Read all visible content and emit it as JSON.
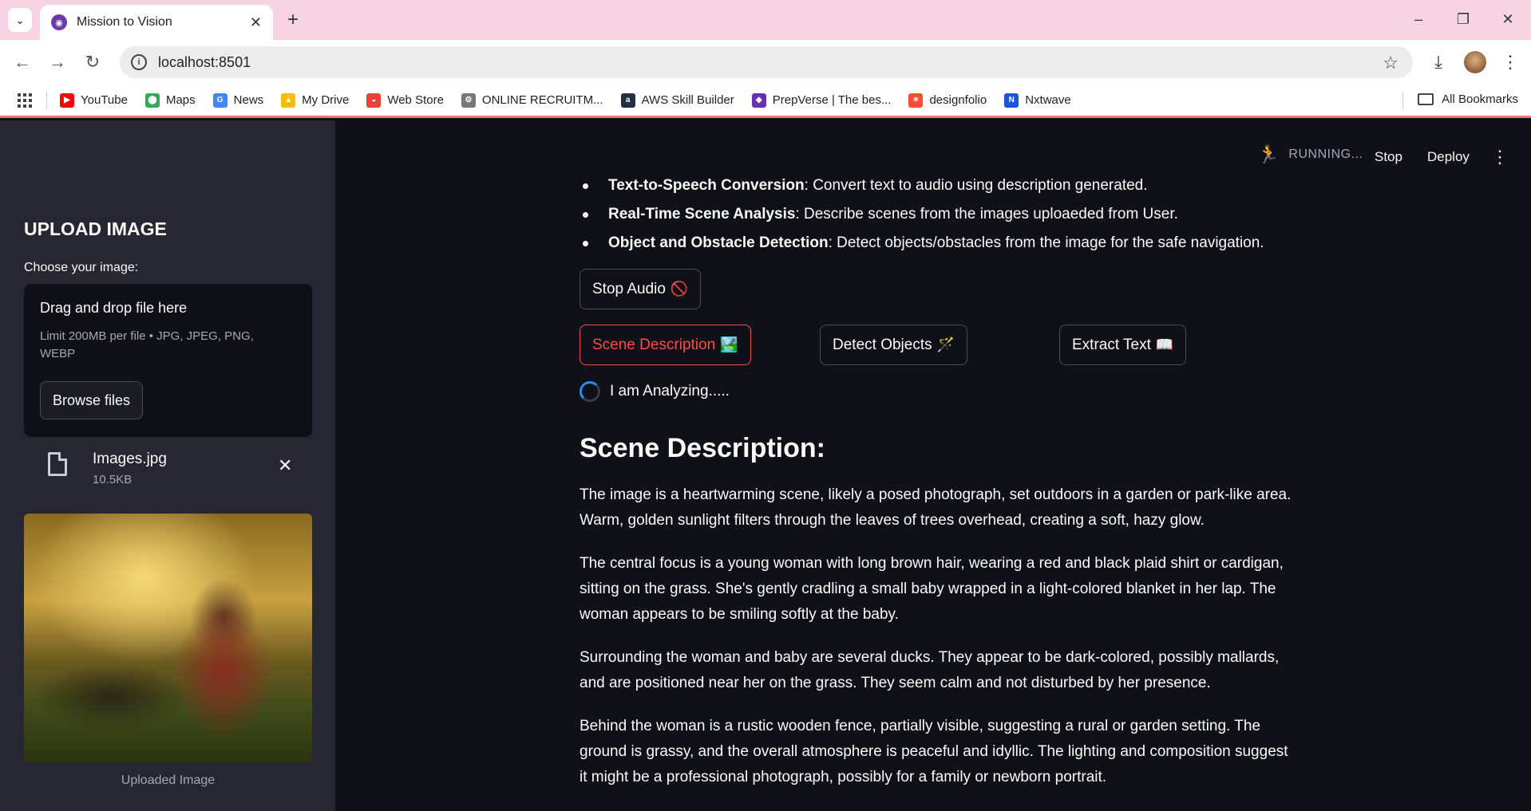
{
  "browser": {
    "tab_title": "Mission to Vision",
    "url": "localhost:8501",
    "bookmarks": [
      {
        "label": "YouTube",
        "icon": "youtube-icon",
        "color": "#ff0000"
      },
      {
        "label": "Maps",
        "icon": "maps-icon",
        "color": "#34a853"
      },
      {
        "label": "News",
        "icon": "news-icon",
        "color": "#4285f4"
      },
      {
        "label": "My Drive",
        "icon": "drive-icon",
        "color": "#fbbc04"
      },
      {
        "label": "Web Store",
        "icon": "webstore-icon",
        "color": "#ea4335"
      },
      {
        "label": "ONLINE RECRUITM...",
        "icon": "recruitment-icon",
        "color": "#777777"
      },
      {
        "label": "AWS Skill Builder",
        "icon": "aws-icon",
        "color": "#232f3e"
      },
      {
        "label": "PrepVerse | The bes...",
        "icon": "prepverse-icon",
        "color": "#6a2fb5"
      },
      {
        "label": "designfolio",
        "icon": "designfolio-icon",
        "color": "#ff4d2e"
      },
      {
        "label": "Nxtwave",
        "icon": "nxtwave-icon",
        "color": "#1a56db"
      }
    ],
    "all_bookmarks": "All Bookmarks"
  },
  "sidebar": {
    "heading": "UPLOAD IMAGE",
    "uploader_label": "Choose your image:",
    "dropzone_title": "Drag and drop file here",
    "dropzone_limit": "Limit 200MB per file • JPG, JPEG, PNG, WEBP",
    "browse_label": "Browse files",
    "file_name": "Images.jpg",
    "file_size": "10.5KB",
    "image_caption": "Uploaded Image"
  },
  "header": {
    "status": "RUNNING...",
    "stop": "Stop",
    "deploy": "Deploy"
  },
  "features": [
    {
      "title": "Text-to-Speech Conversion",
      "text": ": Convert text to audio using description generated."
    },
    {
      "title": "Real-Time Scene Analysis",
      "text": ": Describe scenes from the images uploaeded from User."
    },
    {
      "title": "Object and Obstacle Detection",
      "text": ": Detect objects/obstacles from the image for the safe navigation."
    }
  ],
  "buttons": {
    "stop_audio": "Stop Audio",
    "stop_audio_emoji": "🚫",
    "scene_description": "Scene Description",
    "scene_description_emoji": "🏞️",
    "detect_objects": "Detect Objects",
    "detect_objects_emoji": "🪄",
    "extract_text": "Extract Text",
    "extract_text_emoji": "📖"
  },
  "spinner_text": "I am Analyzing.....",
  "scene": {
    "title": "Scene Description:",
    "paragraphs": [
      "The image is a heartwarming scene, likely a posed photograph, set outdoors in a garden or park-like area. Warm, golden sunlight filters through the leaves of trees overhead, creating a soft, hazy glow.",
      "The central focus is a young woman with long brown hair, wearing a red and black plaid shirt or cardigan, sitting on the grass. She's gently cradling a small baby wrapped in a light-colored blanket in her lap. The woman appears to be smiling softly at the baby.",
      "Surrounding the woman and baby are several ducks. They appear to be dark-colored, possibly mallards, and are positioned near her on the grass. They seem calm and not disturbed by her presence.",
      "Behind the woman is a rustic wooden fence, partially visible, suggesting a rural or garden setting. The ground is grassy, and the overall atmosphere is peaceful and idyllic. The lighting and composition suggest it might be a professional photograph, possibly for a family or newborn portrait."
    ]
  }
}
